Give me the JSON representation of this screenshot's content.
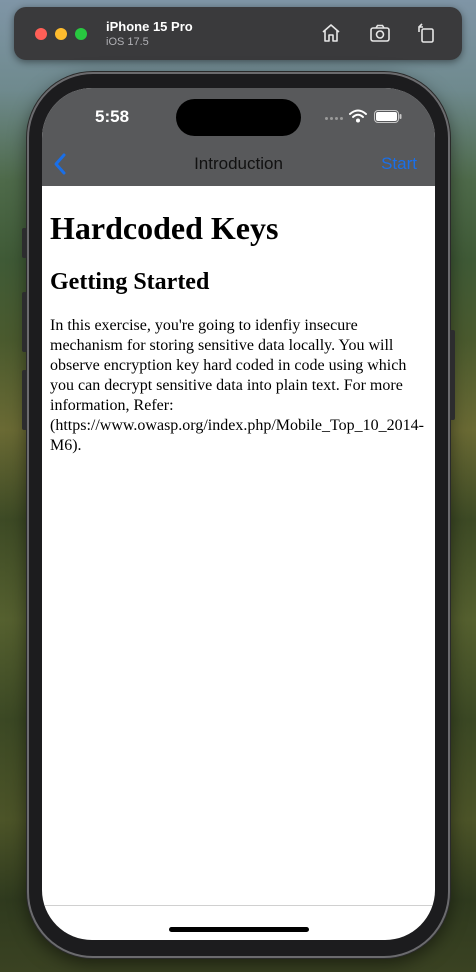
{
  "simulator": {
    "device_name": "iPhone 15 Pro",
    "os_version": "iOS 17.5",
    "icons": [
      "home-icon",
      "screenshot-icon",
      "rotate-icon"
    ]
  },
  "status_bar": {
    "time": "5:58"
  },
  "nav": {
    "back_icon": "chevron-left-icon",
    "title": "Introduction",
    "right_button": "Start",
    "accent_color": "#1a6fe8"
  },
  "content": {
    "heading": "Hardcoded Keys",
    "subheading": "Getting Started",
    "body": "In this exercise, you're going to idenfiy insecure mechanism for storing sensitive data locally. You will observe encryption key hard coded in code using which you can decrypt sensitive data into plain text. For more information, Refer: (https://www.owasp.org/index.php/Mobile_Top_10_2014-M6)."
  }
}
